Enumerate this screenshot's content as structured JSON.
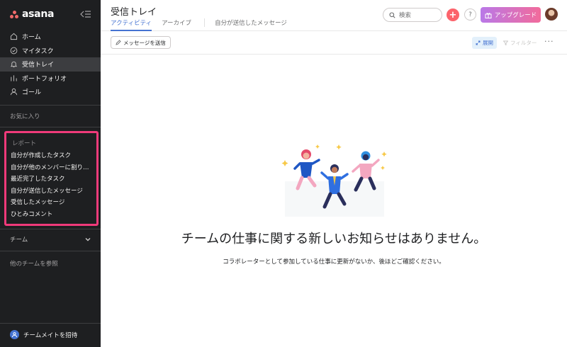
{
  "app": {
    "logo_text": "asana"
  },
  "sidebar": {
    "nav": [
      {
        "label": "ホーム",
        "icon": "home-icon"
      },
      {
        "label": "マイタスク",
        "icon": "check-circle-icon"
      },
      {
        "label": "受信トレイ",
        "icon": "bell-icon",
        "active": true
      },
      {
        "label": "ポートフォリオ",
        "icon": "bar-chart-icon"
      },
      {
        "label": "ゴール",
        "icon": "person-icon"
      }
    ],
    "favorites_label": "お気に入り",
    "reports": {
      "title": "レポート",
      "items": [
        "自分が作成したタスク",
        "自分が他のメンバーに割り当てたタスク",
        "最近完了したタスク",
        "自分が送信したメッセージ",
        "受信したメッセージ",
        "ひとみコメント"
      ]
    },
    "team_label": "チーム",
    "browse_teams": "他のチームを参照",
    "invite_label": "チームメイトを招待"
  },
  "header": {
    "title": "受信トレイ",
    "tabs": [
      "アクティビティ",
      "アーカイブ",
      "自分が送信したメッセージ"
    ],
    "search_placeholder": "検索",
    "help_label": "?",
    "upgrade_label": "アップグレード"
  },
  "toolbar": {
    "send_message": "メッセージを送信",
    "expand": "展開",
    "filter": "フィルター",
    "more": "···"
  },
  "empty_state": {
    "title": "チームの仕事に関する新しいお知らせはありません。",
    "subtitle": "コラボレーターとして参加している仕事に更新がないか、後ほどご確認ください。"
  },
  "colors": {
    "sidebar_bg": "#1e1f21",
    "accent_blue": "#4573d2",
    "highlight_pink": "#f03a7a",
    "plus_coral": "#fc636b"
  }
}
